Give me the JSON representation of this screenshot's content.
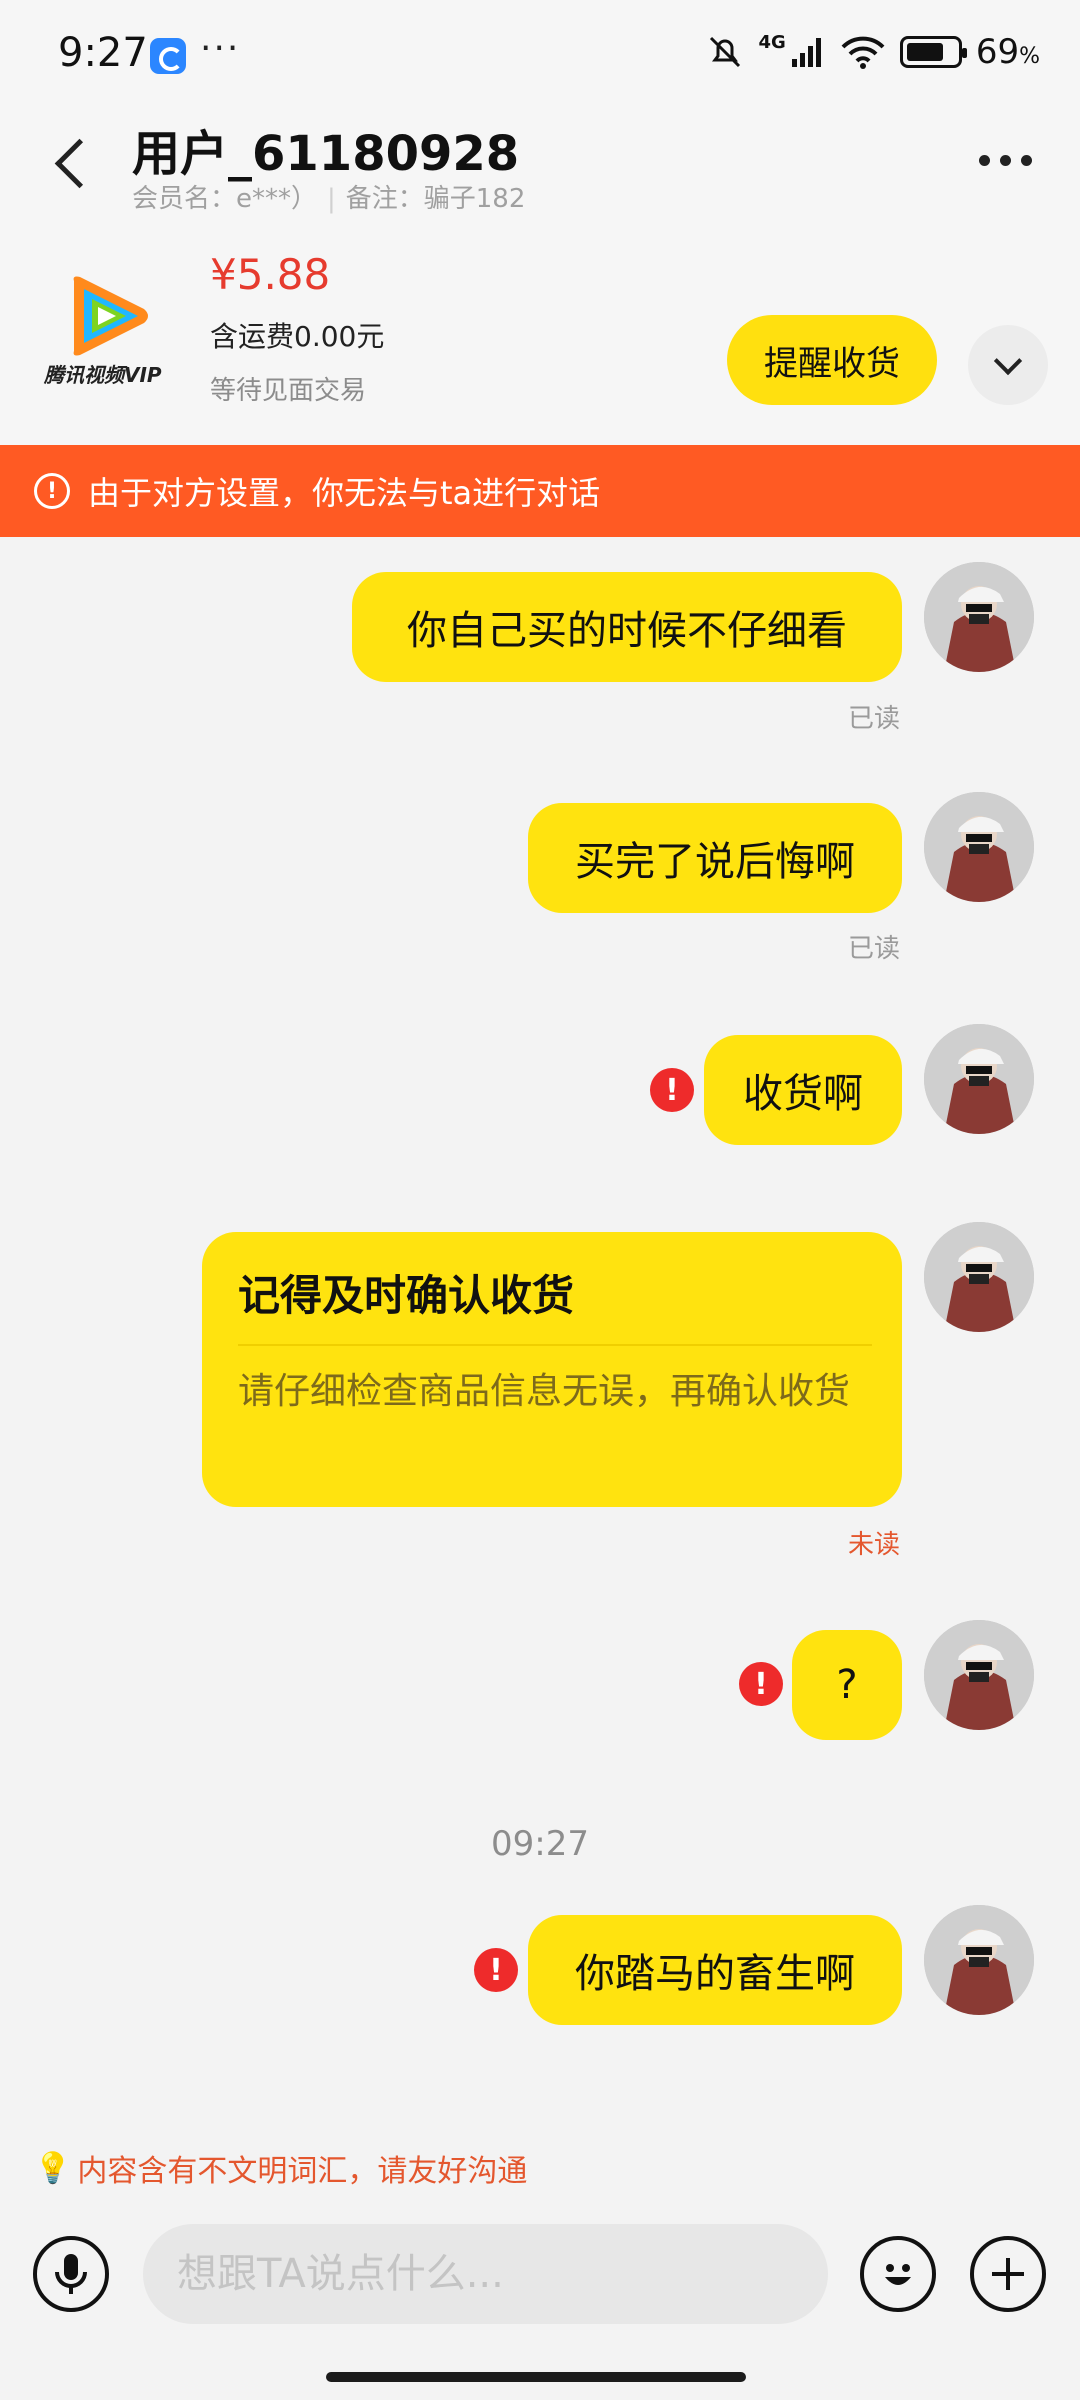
{
  "status_bar": {
    "time": "9:27",
    "network": "4G",
    "battery": "69",
    "battery_unit": "%"
  },
  "header": {
    "title": "用户_61180928",
    "member_label": "会员名：e***）",
    "note_label": "备注：骗子182"
  },
  "order": {
    "logo_text": "腾讯视频VIP",
    "price": "¥5.88",
    "shipping": "含运费0.00元",
    "status": "等待见面交易",
    "remind_button": "提醒收货"
  },
  "banner": {
    "icon": "!",
    "text": "由于对方设置，你无法与ta进行对话"
  },
  "messages": [
    {
      "text": "你自己买的时候不仔细看",
      "read_state": "已读",
      "failed": false
    },
    {
      "text": "买完了说后悔啊",
      "read_state": "已读",
      "failed": false
    },
    {
      "text": "收货啊",
      "read_state": "",
      "failed": true
    },
    {
      "text": "?",
      "read_state": "",
      "failed": true
    },
    {
      "text": "你踏马的畜生啊",
      "read_state": "",
      "failed": true
    }
  ],
  "card_message": {
    "title": "记得及时确认收货",
    "body": "请仔细检查商品信息无误，再确认收货",
    "read_state": "未读"
  },
  "timestamp": "09:27",
  "civility_notice": "内容含有不文明词汇，请友好沟通",
  "input": {
    "placeholder": "想跟TA说点什么..."
  },
  "colors": {
    "accent_yellow": "#ffe30f",
    "banner_orange": "#ff5a23",
    "price_red": "#e63b2e",
    "error_red": "#ee2b2b",
    "warning_text": "#e4572e"
  },
  "icons": [
    "back-arrow-icon",
    "more-icon",
    "chevron-down-icon",
    "alert-icon",
    "error-icon",
    "bulb-icon",
    "microphone-icon",
    "emoji-icon",
    "plus-icon"
  ]
}
